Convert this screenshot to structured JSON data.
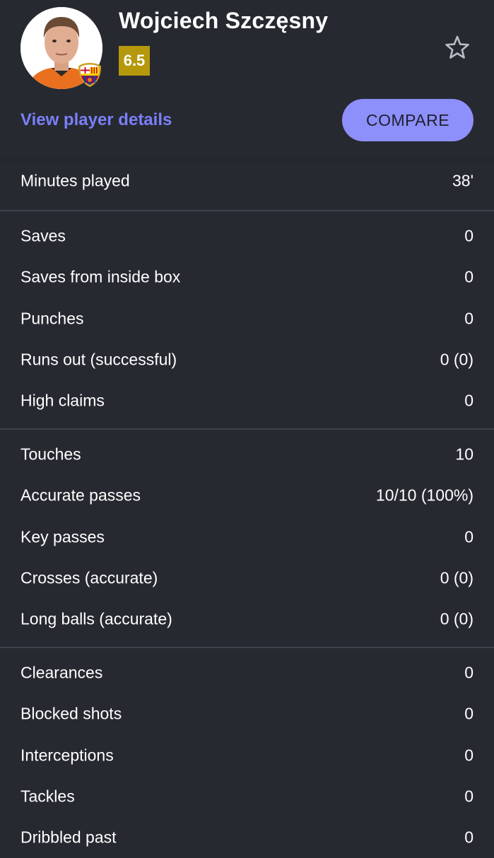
{
  "player": {
    "name": "Wojciech Szczęsny",
    "rating": "6.5",
    "view_details_label": "View player details",
    "compare_label": "COMPARE"
  },
  "colors": {
    "background": "#262930",
    "rating_badge": "#b5980c",
    "link": "#7b7ff7",
    "compare_button": "#8d8ffa",
    "divider": "#3d414b"
  },
  "icons": {
    "favorite": "star-outline-icon",
    "club": "fc-barcelona-crest-icon"
  },
  "stats": {
    "group_1": [
      {
        "label": "Minutes played",
        "value": "38'"
      }
    ],
    "group_2": [
      {
        "label": "Saves",
        "value": "0"
      },
      {
        "label": "Saves from inside box",
        "value": "0"
      },
      {
        "label": "Punches",
        "value": "0"
      },
      {
        "label": "Runs out (successful)",
        "value": "0 (0)"
      },
      {
        "label": "High claims",
        "value": "0"
      }
    ],
    "group_3": [
      {
        "label": "Touches",
        "value": "10"
      },
      {
        "label": "Accurate passes",
        "value": "10/10 (100%)"
      },
      {
        "label": "Key passes",
        "value": "0"
      },
      {
        "label": "Crosses (accurate)",
        "value": "0 (0)"
      },
      {
        "label": "Long balls (accurate)",
        "value": "0 (0)"
      }
    ],
    "group_4": [
      {
        "label": "Clearances",
        "value": "0"
      },
      {
        "label": "Blocked shots",
        "value": "0"
      },
      {
        "label": "Interceptions",
        "value": "0"
      },
      {
        "label": "Tackles",
        "value": "0"
      },
      {
        "label": "Dribbled past",
        "value": "0"
      }
    ]
  }
}
